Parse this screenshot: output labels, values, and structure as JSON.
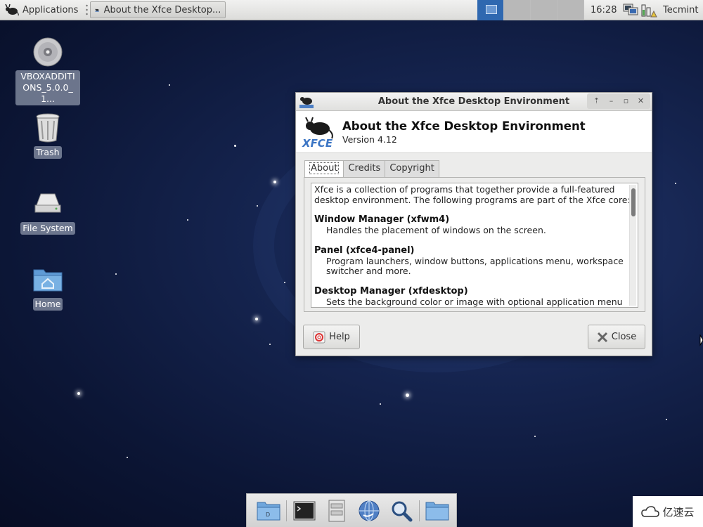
{
  "top_panel": {
    "applications_label": "Applications",
    "task_label": "About the Xfce Desktop...",
    "clock": "16:28",
    "user": "Tecmint",
    "workspace_count": 4,
    "active_workspace": 1
  },
  "desktop_icons": [
    {
      "label": "VBOXADDITIONS_5.0.0_1...",
      "icon": "cd-icon"
    },
    {
      "label": "Trash",
      "icon": "trash-icon"
    },
    {
      "label": "File System",
      "icon": "drive-icon"
    },
    {
      "label": "Home",
      "icon": "home-folder-icon"
    }
  ],
  "window": {
    "title": "About the Xfce Desktop Environment",
    "header_title": "About the Xfce Desktop Environment",
    "version": "Version 4.12",
    "tabs": [
      "About",
      "Credits",
      "Copyright"
    ],
    "active_tab": "About",
    "intro": "Xfce is a collection of programs that together provide a full-featured desktop environment. The following programs are part of the Xfce core:",
    "sections": [
      {
        "heading": "Window Manager (xfwm4)",
        "desc": "Handles the placement of windows on the screen."
      },
      {
        "heading": "Panel (xfce4-panel)",
        "desc": "Program launchers, window buttons, applications menu, workspace switcher and more."
      },
      {
        "heading": "Desktop Manager (xfdesktop)",
        "desc": "Sets the background color or image with optional application menu or icons for minimized applications or launchers, devices and folders."
      }
    ],
    "help_label": "Help",
    "close_label": "Close"
  },
  "dock": {
    "items": [
      "folder-icon",
      "terminal-icon",
      "file-manager-icon",
      "web-browser-icon",
      "search-icon",
      "folder-icon"
    ]
  },
  "watermark": "亿速云",
  "colors": {
    "desktop_bg": "#101c45",
    "active_workspace": "#2f68b0",
    "panel_bg": "#e5e5e3"
  }
}
